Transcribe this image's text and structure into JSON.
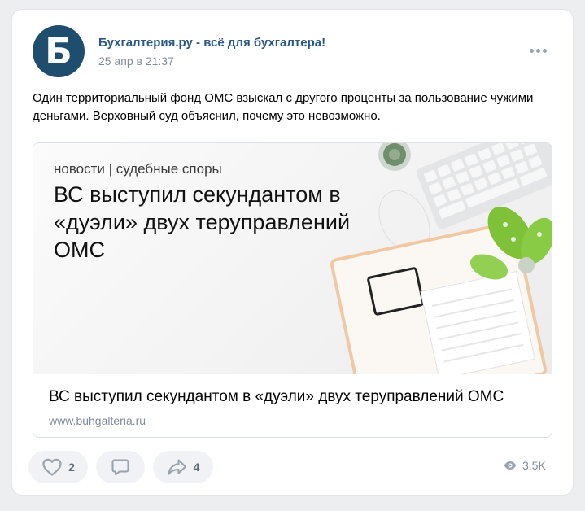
{
  "post": {
    "author": "Бухгалтерия.ру - всё для бухгалтера!",
    "avatar_letter": "Б",
    "date": "25 апр в 21:37",
    "text": "Один территориальный фонд ОМС взыскал с другого проценты за пользование чужими деньгами. Верховный суд объяснил, почему это невозможно."
  },
  "snippet": {
    "image_rubric": "новости | судебные споры",
    "image_headline": "ВС выступил секундантом в «дуэли» двух теруправлений ОМС",
    "title": "ВС выступил секундантом в «дуэли» двух теруправлений ОМС",
    "domain": "www.buhgalteria.ru"
  },
  "actions": {
    "likes": "2",
    "shares": "4",
    "views": "3.5K"
  },
  "icons": {
    "more": "more-dots-icon",
    "like": "heart-icon",
    "comment": "comment-bubble-icon",
    "share": "share-arrow-icon",
    "views": "eye-icon"
  },
  "colors": {
    "author_link": "#2a5885",
    "avatar_bg": "#1f4d6e",
    "muted": "#818c99",
    "button_bg": "#f0f2f5"
  }
}
